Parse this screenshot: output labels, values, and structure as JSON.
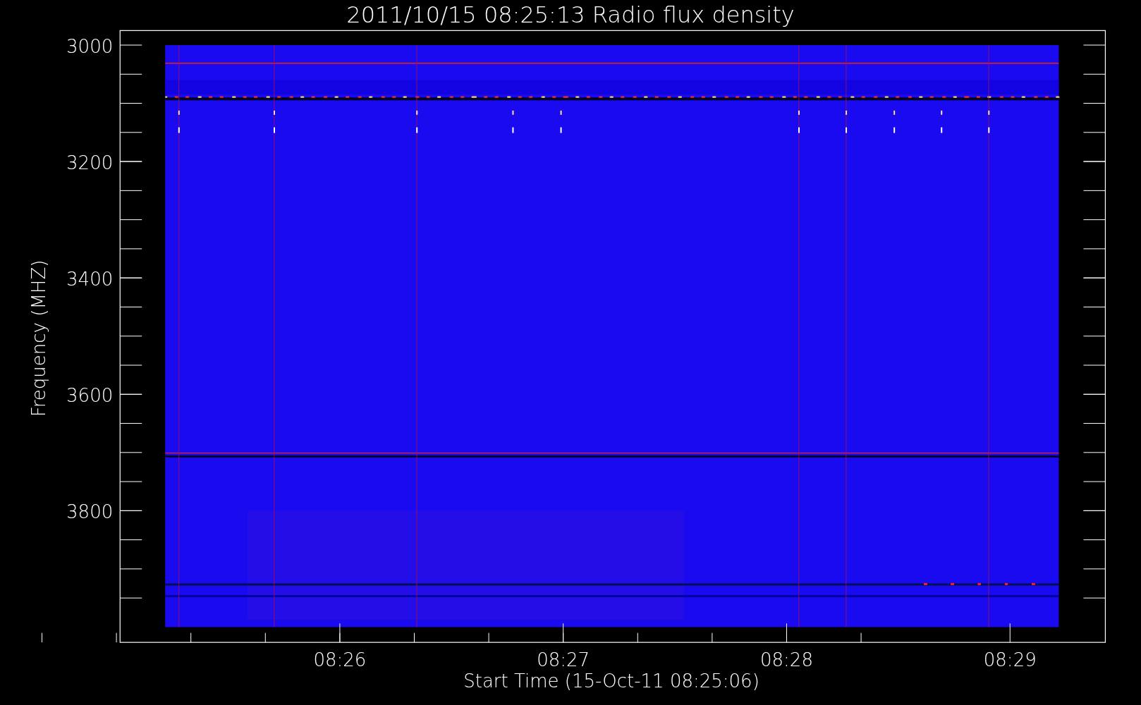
{
  "title": "2011/10/15 08:25:13 Radio flux density",
  "y_axis": {
    "label": "Frequency (MHZ)",
    "ticks": [
      "3000",
      "3200",
      "3400",
      "3600",
      "3800"
    ]
  },
  "x_axis": {
    "label": "Start Time (15-Oct-11 08:25:06)",
    "ticks": [
      "08:26",
      "08:27",
      "08:28",
      "08:29"
    ]
  }
}
